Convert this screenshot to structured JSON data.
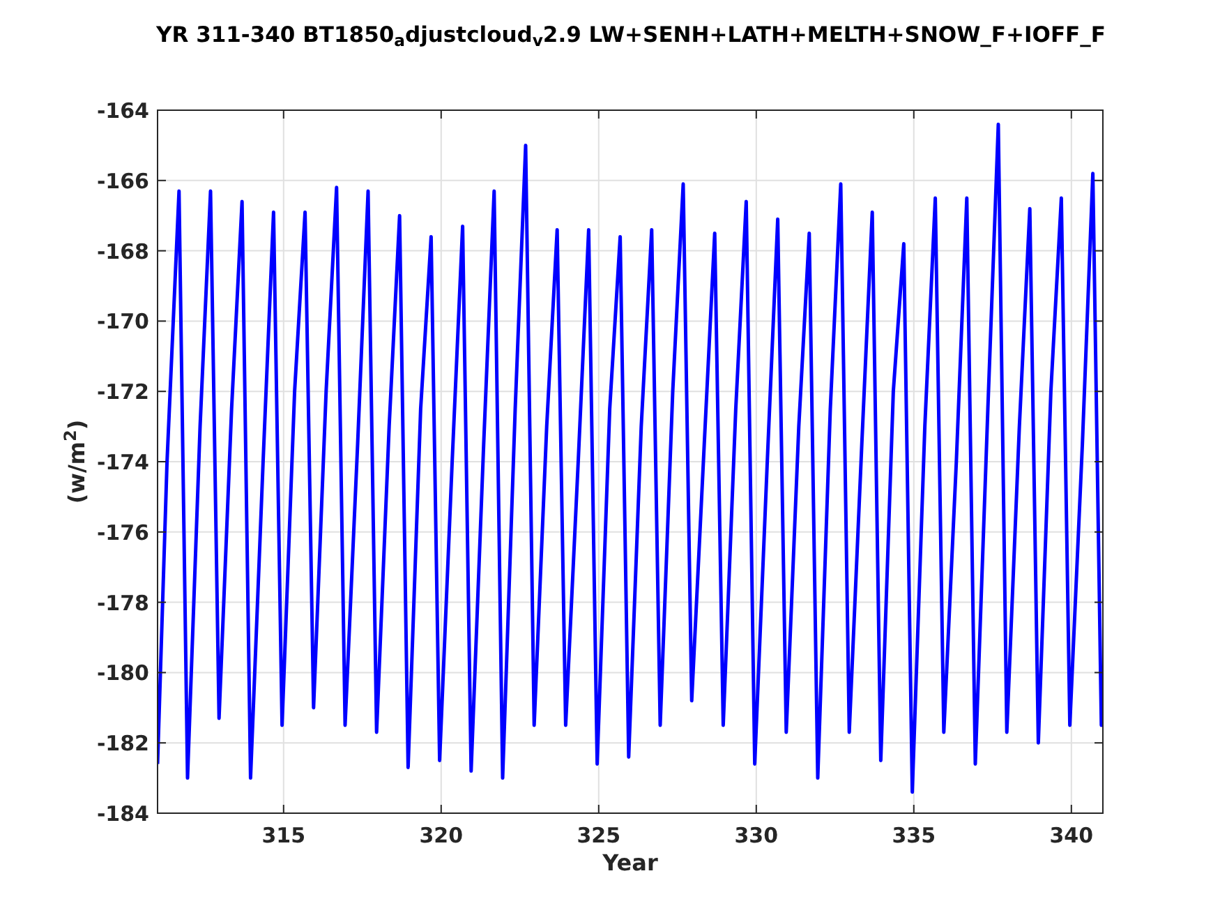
{
  "figure": {
    "chart_data": {
      "type": "line",
      "title": "YR 311-340 BT1850$_{a}$djustcloud$_{v}$2.9 LW+SENH+LATH+MELTH+SNOW_F+IOFF_F",
      "xlabel": "Year",
      "ylabel": "(w/m$^{2}$)",
      "xlim": [
        311,
        341
      ],
      "ylim": [
        -184,
        -164
      ],
      "grid": true,
      "xticks": [
        315,
        320,
        325,
        330,
        335,
        340
      ],
      "yticks": [
        -184,
        -182,
        -180,
        -178,
        -176,
        -174,
        -172,
        -170,
        -168,
        -166,
        -164
      ],
      "x": [
        311,
        311.3,
        311.68,
        311.95,
        312.35,
        312.68,
        312.95,
        313.35,
        313.68,
        313.95,
        314.35,
        314.68,
        314.95,
        315.35,
        315.68,
        315.95,
        316.35,
        316.68,
        316.95,
        317.35,
        317.68,
        317.95,
        318.35,
        318.68,
        318.95,
        319.35,
        319.68,
        319.95,
        320.35,
        320.68,
        320.95,
        321.35,
        321.68,
        321.95,
        322.35,
        322.68,
        322.95,
        323.35,
        323.68,
        323.95,
        324.35,
        324.68,
        324.95,
        325.35,
        325.68,
        325.95,
        326.35,
        326.68,
        326.95,
        327.35,
        327.68,
        327.95,
        328.35,
        328.68,
        328.95,
        329.35,
        329.68,
        329.95,
        330.35,
        330.68,
        330.95,
        331.35,
        331.68,
        331.95,
        332.35,
        332.68,
        332.95,
        333.35,
        333.68,
        333.95,
        334.35,
        334.68,
        334.95,
        335.35,
        335.68,
        335.95,
        336.35,
        336.68,
        336.95,
        337.35,
        337.68,
        337.95,
        338.35,
        338.68,
        338.95,
        339.35,
        339.68,
        339.95,
        340.35,
        340.68,
        340.95,
        341
      ],
      "series": [
        {
          "color": "#0000ff",
          "values": [
            -182.6,
            -174,
            -166.3,
            -183,
            -173,
            -166.3,
            -181.3,
            -172.5,
            -166.6,
            -183,
            -174,
            -166.9,
            -181.5,
            -172,
            -166.9,
            -181,
            -172,
            -166.2,
            -181.5,
            -173.5,
            -166.3,
            -181.7,
            -173,
            -167,
            -182.7,
            -172.5,
            -167.6,
            -182.5,
            -174,
            -167.3,
            -182.8,
            -173.5,
            -166.3,
            -183,
            -172.5,
            -165,
            -181.5,
            -173,
            -167.4,
            -181.5,
            -174,
            -167.4,
            -182.6,
            -172.5,
            -167.6,
            -182.4,
            -173,
            -167.4,
            -181.5,
            -172,
            -166.1,
            -180.8,
            -173.5,
            -167.5,
            -181.5,
            -172.5,
            -166.6,
            -182.6,
            -174,
            -167.1,
            -181.7,
            -173,
            -167.5,
            -183,
            -172.5,
            -166.1,
            -181.7,
            -173.5,
            -166.9,
            -182.5,
            -172,
            -167.8,
            -183.4,
            -173,
            -166.5,
            -181.7,
            -174,
            -166.5,
            -182.6,
            -172.5,
            -164.4,
            -181.7,
            -173,
            -166.8,
            -182,
            -172,
            -166.5,
            -181.5,
            -173.5,
            -165.8,
            -181.5,
            -180.7
          ]
        }
      ]
    }
  }
}
